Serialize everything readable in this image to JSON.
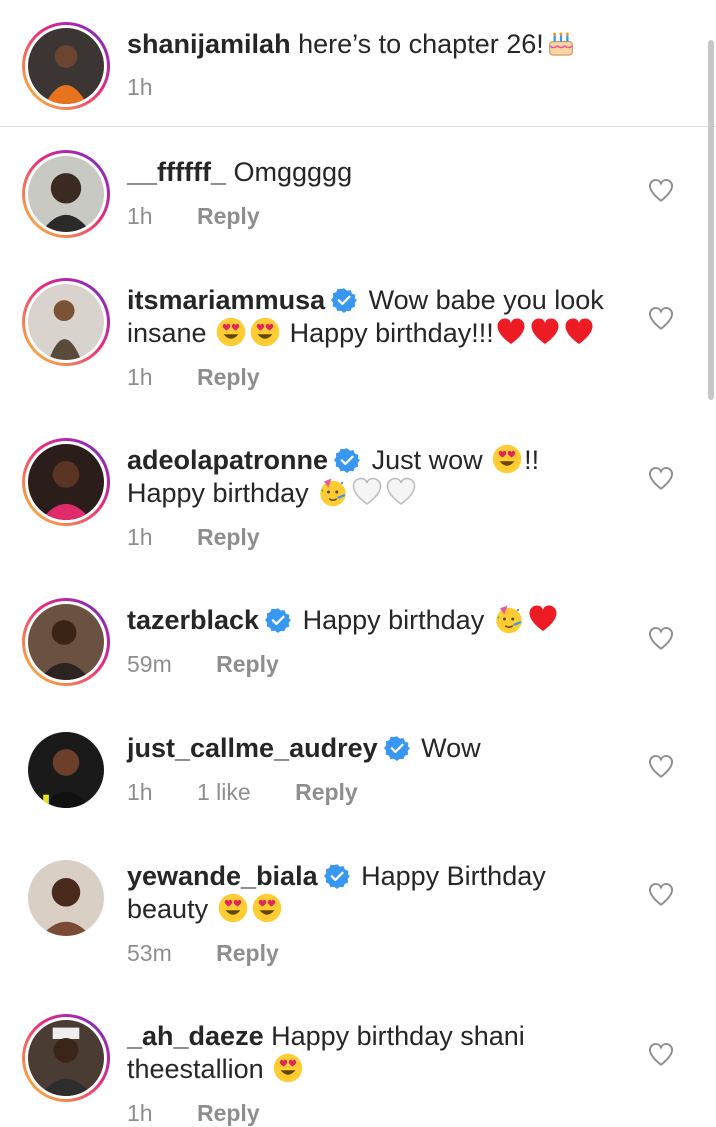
{
  "caption": {
    "username": "shanijamilah",
    "text": "here’s to chapter 26!",
    "time": "1h"
  },
  "comments": [
    {
      "username": "__ffffff_",
      "verified": false,
      "text": "Omggggg",
      "time": "1h",
      "likes": "",
      "reply": "Reply"
    },
    {
      "username": "itsmariammusa",
      "verified": true,
      "text": "Wow babe you look insane",
      "text2": "Happy birthday!!!",
      "time": "1h",
      "likes": "",
      "reply": "Reply"
    },
    {
      "username": "adeolapatronne",
      "verified": true,
      "text": "Just wow",
      "text_b": "!!",
      "text2": "Happy birthday",
      "time": "1h",
      "likes": "",
      "reply": "Reply"
    },
    {
      "username": "tazerblack",
      "verified": true,
      "text": "Happy birthday",
      "time": "59m",
      "likes": "",
      "reply": "Reply"
    },
    {
      "username": "just_callme_audrey",
      "verified": true,
      "text": "Wow",
      "time": "1h",
      "likes": "1 like",
      "reply": "Reply"
    },
    {
      "username": "yewande_biala",
      "verified": true,
      "text": "Happy Birthday",
      "text2": "beauty",
      "time": "53m",
      "likes": "",
      "reply": "Reply"
    },
    {
      "username": "_ah_daeze",
      "verified": false,
      "text": "Happy birthday shani",
      "text2": "theestallion",
      "time": "1h",
      "likes": "",
      "reply": "Reply"
    }
  ],
  "colors": {
    "text": "#262626",
    "meta": "#8e8e8e",
    "verified": "#3897f0",
    "heart_red": "#ed1b24",
    "divider": "#dbdbdb"
  },
  "icons": [
    "heart-outline-icon",
    "verified-badge-icon",
    "birthday-cake-emoji",
    "heart-eyes-emoji",
    "red-heart-emoji",
    "party-face-emoji",
    "white-heart-emoji"
  ]
}
